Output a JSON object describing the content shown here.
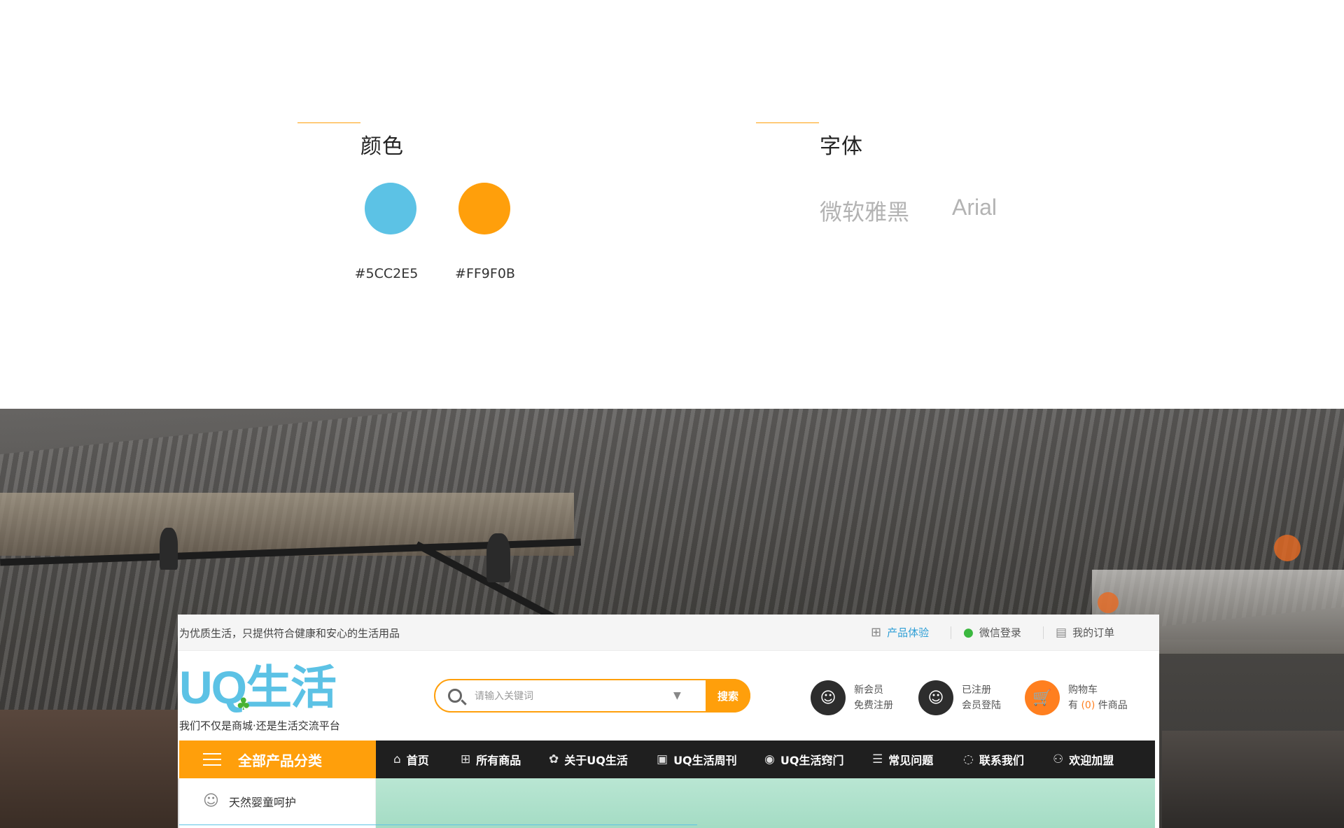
{
  "style_guide": {
    "color_title": "颜色",
    "font_title": "字体",
    "colors": [
      {
        "hex": "#5CC2E5",
        "label": "#5CC2E5"
      },
      {
        "hex": "#FF9F0B",
        "label": "#FF9F0B"
      }
    ],
    "color_labels": [
      "#5CC2E5",
      "#FF9F0B"
    ],
    "fonts": [
      "微软雅黑",
      "Arial"
    ]
  },
  "site": {
    "slogan": "为优质生活，只提供符合健康和安心的生活用品",
    "top_links": [
      {
        "label": "产品体验",
        "icon": "grid-icon"
      },
      {
        "label": "微信登录",
        "icon": "wechat-icon"
      },
      {
        "label": "我的订单",
        "icon": "order-icon"
      }
    ],
    "logo": {
      "text": "UQ生活",
      "tagline": "我们不仅是商城·还是生活交流平台"
    },
    "search": {
      "placeholder": "请输入关键词",
      "button": "搜索"
    },
    "members": [
      {
        "line1": "新会员",
        "line2": "免费注册",
        "icon": "user-add-icon"
      },
      {
        "line1": "已注册",
        "line2": "会员登陆",
        "icon": "user-login-icon"
      },
      {
        "line1": "购物车",
        "line2_prefix": "有",
        "count": "(0)",
        "line2_suffix": "件商品",
        "icon": "cart-icon"
      }
    ],
    "category_button": "全部产品分类",
    "nav": [
      {
        "label": "首页",
        "icon": "home-icon"
      },
      {
        "label": "所有商品",
        "icon": "apps-icon"
      },
      {
        "label": "关于UQ生活",
        "icon": "aperture-icon"
      },
      {
        "label": "UQ生活周刊",
        "icon": "magazine-icon"
      },
      {
        "label": "UQ生活窍门",
        "icon": "bulb-icon"
      },
      {
        "label": "常见问题",
        "icon": "faq-icon"
      },
      {
        "label": "联系我们",
        "icon": "chat-icon"
      },
      {
        "label": "欢迎加盟",
        "icon": "join-icon"
      }
    ],
    "side_categories": [
      {
        "label": "天然婴童呵护",
        "icon": "baby-icon"
      }
    ]
  },
  "accent_colors": {
    "blue": "#5CC2E5",
    "orange": "#FF9F0B",
    "nav_dark": "#1f1f1f"
  }
}
